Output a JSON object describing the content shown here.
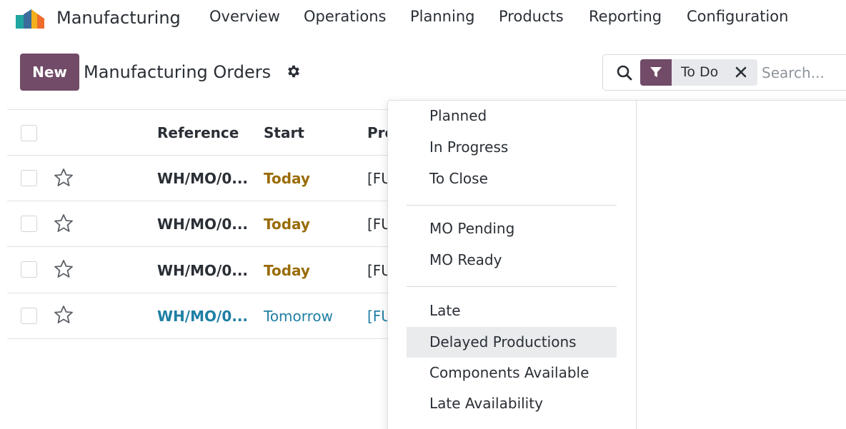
{
  "navbar": {
    "app_name": "Manufacturing",
    "menus": [
      "Overview",
      "Operations",
      "Planning",
      "Products",
      "Reporting",
      "Configuration"
    ]
  },
  "control_panel": {
    "new_label": "New",
    "title": "Manufacturing Orders"
  },
  "search": {
    "facet_label": "To Do",
    "placeholder": "Search..."
  },
  "list": {
    "columns": [
      "Reference",
      "Start",
      "Pro"
    ],
    "rows": [
      {
        "reference": "WH/MO/0...",
        "start": "Today",
        "product": "[FU"
      },
      {
        "reference": "WH/MO/0...",
        "start": "Today",
        "product": "[FU"
      },
      {
        "reference": "WH/MO/0...",
        "start": "Today",
        "product": "[FU"
      },
      {
        "reference": "WH/MO/0...",
        "start": "Tomorrow",
        "product": "[FU"
      }
    ]
  },
  "filter_menu": {
    "group1": [
      "Planned",
      "In Progress",
      "To Close"
    ],
    "group2": [
      "MO Pending",
      "MO Ready"
    ],
    "group3": [
      "Late",
      "Delayed Productions",
      "Components Available",
      "Late Availability"
    ],
    "active_item": "Delayed Productions"
  },
  "colors": {
    "brand": "#714b67",
    "today": "#9a6c08",
    "tomorrow": "#1f7fa5"
  }
}
